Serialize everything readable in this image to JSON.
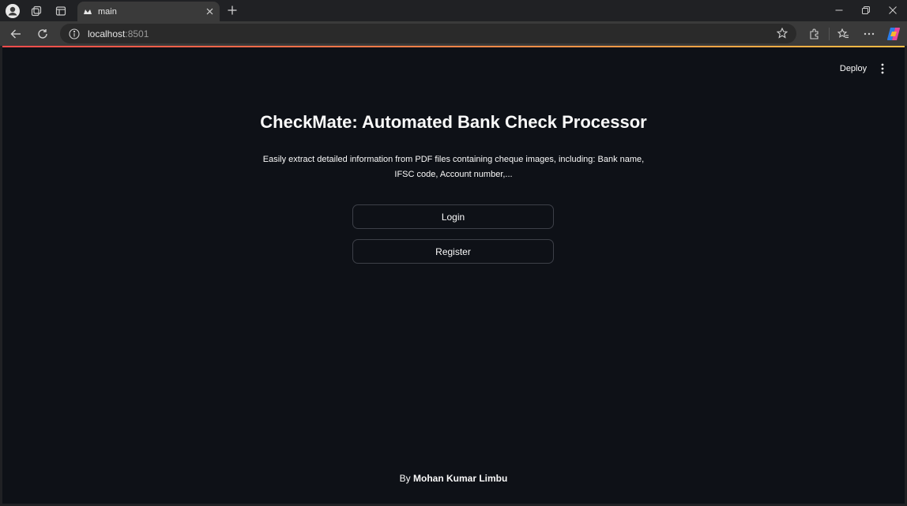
{
  "browser": {
    "tab_title": "main",
    "url_host": "localhost",
    "url_port": ":8501"
  },
  "page": {
    "deploy_label": "Deploy",
    "title": "CheckMate: Automated Bank Check Processor",
    "description": "Easily extract detailed information from PDF files containing cheque images, including: Bank name, IFSC code, Account number,...",
    "login_label": "Login",
    "register_label": "Register",
    "footer_prefix": "By ",
    "footer_author": "Mohan Kumar Limbu"
  },
  "colors": {
    "page_background": "#0e1117",
    "text": "#fafafa",
    "accent_gradient_start": "#ff4b4b",
    "accent_gradient_end": "#ffbd45"
  },
  "icons": [
    "profile-icon",
    "collections-icon",
    "tab-actions-icon",
    "streamlit-favicon",
    "close-icon",
    "plus-icon",
    "minimize-icon",
    "restore-icon",
    "window-close-icon",
    "back-icon",
    "reload-icon",
    "info-icon",
    "favorite-star-icon",
    "extensions-icon",
    "favorites-icon",
    "more-icon",
    "copilot-icon",
    "vertical-dots-icon"
  ]
}
